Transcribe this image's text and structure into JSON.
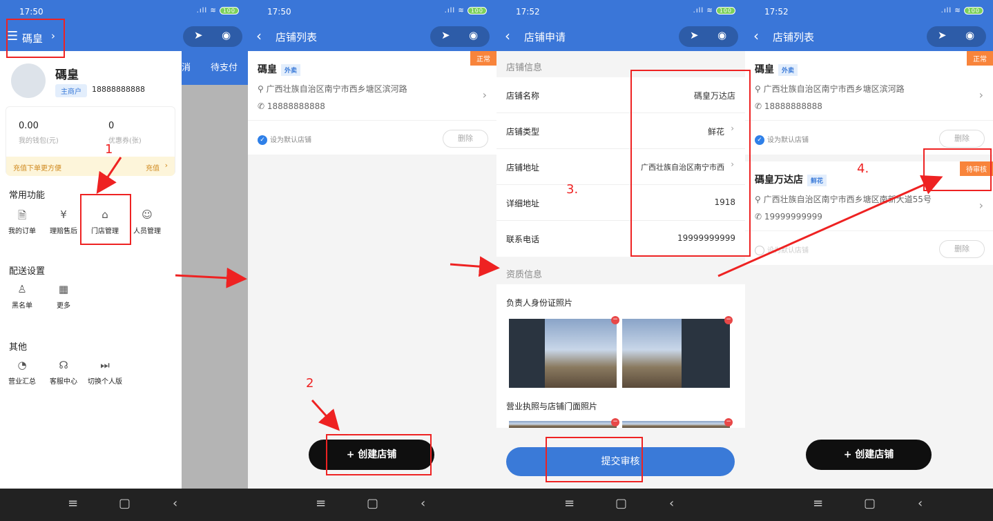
{
  "status": {
    "time_a": "17:50",
    "time_b": "17:52",
    "battery": "100"
  },
  "screen1": {
    "menu_title": "碼皇",
    "user_name": "碼皇",
    "role_badge": "主商户",
    "phone": "18888888888",
    "wallet_value": "0.00",
    "wallet_label": "我的钱包(元)",
    "coupon_value": "0",
    "coupon_label": "优惠券(张)",
    "promo_text": "充值下单更方便",
    "promo_action": "充值",
    "bg_tabs": [
      "消",
      "待支付"
    ],
    "common_title": "常用功能",
    "common_items": [
      {
        "label": "我的订单",
        "icon": "order-icon"
      },
      {
        "label": "理赔售后",
        "icon": "claim-icon"
      },
      {
        "label": "门店管理",
        "icon": "store-icon"
      },
      {
        "label": "人员管理",
        "icon": "staff-icon"
      }
    ],
    "delivery_title": "配送设置",
    "delivery_items": [
      {
        "label": "黑名单",
        "icon": "blacklist-icon"
      },
      {
        "label": "更多",
        "icon": "grid-icon"
      }
    ],
    "other_title": "其他",
    "other_items": [
      {
        "label": "营业汇总",
        "icon": "chart-icon"
      },
      {
        "label": "客服中心",
        "icon": "headset-icon"
      },
      {
        "label": "切换个人版",
        "icon": "switch-icon"
      }
    ]
  },
  "screen2": {
    "title": "店铺列表",
    "store": {
      "name": "碼皇",
      "type": "外卖",
      "status": "正常",
      "address": "广西壮族自治区南宁市西乡塘区滨河路",
      "phone": "18888888888",
      "default_label": "设为默认店铺",
      "delete_label": "删除"
    },
    "create_button": "+ 创建店铺"
  },
  "screen3": {
    "title": "店铺申请",
    "section_info": "店铺信息",
    "fields": [
      {
        "label": "店铺名称",
        "value": "碼皇万达店"
      },
      {
        "label": "店铺类型",
        "value": "鲜花"
      },
      {
        "label": "店铺地址",
        "value": "广西壮族自治区南宁市西"
      },
      {
        "label": "详细地址",
        "value": "1918"
      },
      {
        "label": "联系电话",
        "value": "19999999999"
      }
    ],
    "section_qual": "资质信息",
    "id_photo_label": "负责人身份证照片",
    "license_photo_label": "营业执照与店铺门面照片",
    "submit_button": "提交审核"
  },
  "screen4": {
    "title": "店铺列表",
    "stores": [
      {
        "name": "碼皇",
        "type": "外卖",
        "status": "正常",
        "address": "广西壮族自治区南宁市西乡塘区滨河路",
        "phone": "18888888888",
        "default_label": "设为默认店铺",
        "delete_label": "删除"
      },
      {
        "name": "碼皇万达店",
        "type": "鲜花",
        "status": "待审核",
        "address": "广西壮族自治区南宁市西乡塘区南新大道55号",
        "phone": "19999999999",
        "default_label": "设为默认店铺",
        "delete_label": "删除"
      }
    ],
    "create_button": "+ 创建店铺"
  },
  "steps": [
    "1",
    "2",
    "3.",
    "4."
  ],
  "colors": {
    "primary": "#3a76d8",
    "annotation": "#ee2222",
    "status_orange": "#f8843b"
  }
}
